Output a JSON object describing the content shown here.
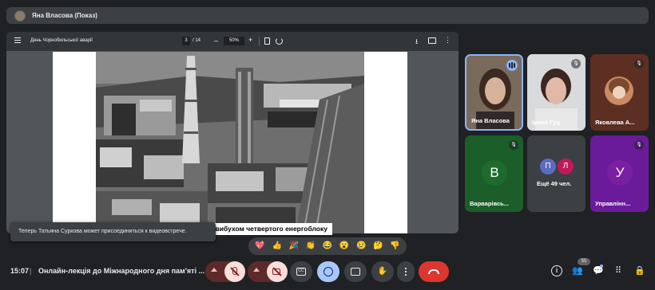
{
  "presenter": {
    "name": "Яна Власова (Показ)"
  },
  "pdf": {
    "title": "День Чорнобильської аварії",
    "page_current": "3",
    "page_total": "/ 14",
    "zoom": "50%",
    "zoom_minus": "–",
    "zoom_plus": "+",
    "caption": "о вибухом четвертого енергоблоку"
  },
  "toast": "Теперь Татьяна Суркова может присоединиться к видеовстрече.",
  "participants": [
    {
      "name": "Яна Власова",
      "speaking": true
    },
    {
      "name": "Ірина Гуц",
      "mic": "muted"
    },
    {
      "name": "Яковлева А...",
      "mic": "muted"
    },
    {
      "name": "Варварівсь...",
      "letter": "В",
      "color": "#1e6b2e",
      "mic": "muted"
    },
    {
      "name": "Ещё 49 чел.",
      "letters": [
        "П",
        "Л"
      ]
    },
    {
      "name": "Управлінн...",
      "letter": "У",
      "color": "#7b1fa2",
      "mic": "muted"
    }
  ],
  "reactions": [
    "💖",
    "👍",
    "🎉",
    "👏",
    "😂",
    "😮",
    "😢",
    "🤔",
    "👎"
  ],
  "bottom": {
    "time": "15:07",
    "separator": "|",
    "meeting_title": "Онлайн-лекція до Міжнародного дня пам'яті ...",
    "people_count": "55"
  },
  "colors": {
    "background": "#202124",
    "tile_active_border": "#8ab4f8",
    "leave_red": "#dc362e",
    "muted_pink": "#f9dedc"
  }
}
